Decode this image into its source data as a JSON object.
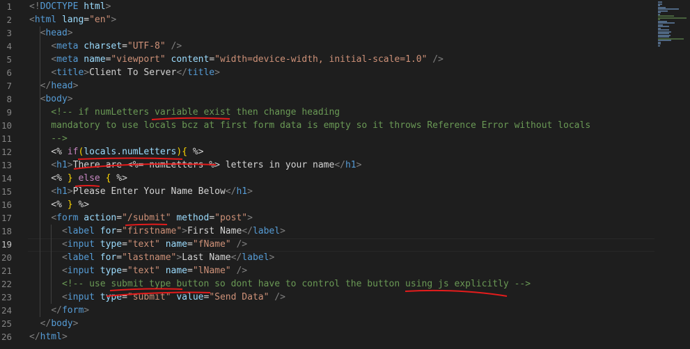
{
  "editor": {
    "active_line": 19,
    "lines": [
      {
        "n": "1",
        "t": [
          {
            "c": "t-p",
            "v": "<!"
          },
          {
            "c": "t-tag",
            "v": "DOCTYPE"
          },
          {
            "c": "t-text",
            "v": " "
          },
          {
            "c": "t-attr",
            "v": "html"
          },
          {
            "c": "t-p",
            "v": ">"
          }
        ]
      },
      {
        "n": "2",
        "t": [
          {
            "c": "t-p",
            "v": "<"
          },
          {
            "c": "t-tag",
            "v": "html"
          },
          {
            "c": "t-text",
            "v": " "
          },
          {
            "c": "t-attr",
            "v": "lang"
          },
          {
            "c": "t-text",
            "v": "="
          },
          {
            "c": "t-str",
            "v": "\"en\""
          },
          {
            "c": "t-p",
            "v": ">"
          }
        ]
      },
      {
        "n": "3",
        "t": [
          {
            "c": "t-text",
            "v": "  "
          },
          {
            "c": "t-p",
            "v": "<"
          },
          {
            "c": "t-tag",
            "v": "head"
          },
          {
            "c": "t-p",
            "v": ">"
          }
        ]
      },
      {
        "n": "4",
        "t": [
          {
            "c": "t-text",
            "v": "    "
          },
          {
            "c": "t-p",
            "v": "<"
          },
          {
            "c": "t-tag",
            "v": "meta"
          },
          {
            "c": "t-text",
            "v": " "
          },
          {
            "c": "t-attr",
            "v": "charset"
          },
          {
            "c": "t-text",
            "v": "="
          },
          {
            "c": "t-str",
            "v": "\"UTF-8\""
          },
          {
            "c": "t-text",
            "v": " "
          },
          {
            "c": "t-p",
            "v": "/>"
          }
        ]
      },
      {
        "n": "5",
        "t": [
          {
            "c": "t-text",
            "v": "    "
          },
          {
            "c": "t-p",
            "v": "<"
          },
          {
            "c": "t-tag",
            "v": "meta"
          },
          {
            "c": "t-text",
            "v": " "
          },
          {
            "c": "t-attr",
            "v": "name"
          },
          {
            "c": "t-text",
            "v": "="
          },
          {
            "c": "t-str",
            "v": "\"viewport\""
          },
          {
            "c": "t-text",
            "v": " "
          },
          {
            "c": "t-attr",
            "v": "content"
          },
          {
            "c": "t-text",
            "v": "="
          },
          {
            "c": "t-str",
            "v": "\"width=device-width, initial-scale=1.0\""
          },
          {
            "c": "t-text",
            "v": " "
          },
          {
            "c": "t-p",
            "v": "/>"
          }
        ]
      },
      {
        "n": "6",
        "t": [
          {
            "c": "t-text",
            "v": "    "
          },
          {
            "c": "t-p",
            "v": "<"
          },
          {
            "c": "t-tag",
            "v": "title"
          },
          {
            "c": "t-p",
            "v": ">"
          },
          {
            "c": "t-text",
            "v": "Client To Server"
          },
          {
            "c": "t-p",
            "v": "</"
          },
          {
            "c": "t-tag",
            "v": "title"
          },
          {
            "c": "t-p",
            "v": ">"
          }
        ]
      },
      {
        "n": "7",
        "t": [
          {
            "c": "t-text",
            "v": "  "
          },
          {
            "c": "t-p",
            "v": "</"
          },
          {
            "c": "t-tag",
            "v": "head"
          },
          {
            "c": "t-p",
            "v": ">"
          }
        ]
      },
      {
        "n": "8",
        "t": [
          {
            "c": "t-text",
            "v": "  "
          },
          {
            "c": "t-p",
            "v": "<"
          },
          {
            "c": "t-tag",
            "v": "body"
          },
          {
            "c": "t-p",
            "v": ">"
          }
        ]
      },
      {
        "n": "9",
        "t": [
          {
            "c": "t-com",
            "v": "    <!-- if numLetters variable exist then change heading"
          }
        ]
      },
      {
        "n": "10",
        "t": [
          {
            "c": "t-com",
            "v": "    mandatory to use locals bcz at first form data is empty so it throws Reference Error without locals"
          }
        ]
      },
      {
        "n": "11",
        "t": [
          {
            "c": "t-com",
            "v": "    -->"
          }
        ]
      },
      {
        "n": "12",
        "t": [
          {
            "c": "t-text",
            "v": "    <% "
          },
          {
            "c": "t-kw",
            "v": "if"
          },
          {
            "c": "t-br",
            "v": "("
          },
          {
            "c": "t-var",
            "v": "locals"
          },
          {
            "c": "t-text",
            "v": "."
          },
          {
            "c": "t-var",
            "v": "numLetters"
          },
          {
            "c": "t-br",
            "v": ")"
          },
          {
            "c": "t-br",
            "v": "{"
          },
          {
            "c": "t-text",
            "v": " %>"
          }
        ]
      },
      {
        "n": "13",
        "t": [
          {
            "c": "t-text",
            "v": "    "
          },
          {
            "c": "t-p",
            "v": "<"
          },
          {
            "c": "t-tag",
            "v": "h1"
          },
          {
            "c": "t-p",
            "v": ">"
          },
          {
            "c": "t-text",
            "v": "There are <%= numLetters %> letters in your name"
          },
          {
            "c": "t-p",
            "v": "</"
          },
          {
            "c": "t-tag",
            "v": "h1"
          },
          {
            "c": "t-p",
            "v": ">"
          }
        ]
      },
      {
        "n": "14",
        "t": [
          {
            "c": "t-text",
            "v": "    <% "
          },
          {
            "c": "t-br",
            "v": "}"
          },
          {
            "c": "t-text",
            "v": " "
          },
          {
            "c": "t-kw",
            "v": "else"
          },
          {
            "c": "t-text",
            "v": " "
          },
          {
            "c": "t-br",
            "v": "{"
          },
          {
            "c": "t-text",
            "v": " %>"
          }
        ]
      },
      {
        "n": "15",
        "t": [
          {
            "c": "t-text",
            "v": "    "
          },
          {
            "c": "t-p",
            "v": "<"
          },
          {
            "c": "t-tag",
            "v": "h1"
          },
          {
            "c": "t-p",
            "v": ">"
          },
          {
            "c": "t-text",
            "v": "Please Enter Your Name Below"
          },
          {
            "c": "t-p",
            "v": "</"
          },
          {
            "c": "t-tag",
            "v": "h1"
          },
          {
            "c": "t-p",
            "v": ">"
          }
        ]
      },
      {
        "n": "16",
        "t": [
          {
            "c": "t-text",
            "v": "    <% "
          },
          {
            "c": "t-br",
            "v": "}"
          },
          {
            "c": "t-text",
            "v": " %>"
          }
        ]
      },
      {
        "n": "17",
        "t": [
          {
            "c": "t-text",
            "v": "    "
          },
          {
            "c": "t-p",
            "v": "<"
          },
          {
            "c": "t-tag",
            "v": "form"
          },
          {
            "c": "t-text",
            "v": " "
          },
          {
            "c": "t-attr",
            "v": "action"
          },
          {
            "c": "t-text",
            "v": "="
          },
          {
            "c": "t-str",
            "v": "\"/submit\""
          },
          {
            "c": "t-text",
            "v": " "
          },
          {
            "c": "t-attr",
            "v": "method"
          },
          {
            "c": "t-text",
            "v": "="
          },
          {
            "c": "t-str",
            "v": "\"post\""
          },
          {
            "c": "t-p",
            "v": ">"
          }
        ]
      },
      {
        "n": "18",
        "t": [
          {
            "c": "t-text",
            "v": "      "
          },
          {
            "c": "t-p",
            "v": "<"
          },
          {
            "c": "t-tag",
            "v": "label"
          },
          {
            "c": "t-text",
            "v": " "
          },
          {
            "c": "t-attr",
            "v": "for"
          },
          {
            "c": "t-text",
            "v": "="
          },
          {
            "c": "t-str",
            "v": "\"firstname\""
          },
          {
            "c": "t-p",
            "v": ">"
          },
          {
            "c": "t-text",
            "v": "First Name"
          },
          {
            "c": "t-p",
            "v": "</"
          },
          {
            "c": "t-tag",
            "v": "label"
          },
          {
            "c": "t-p",
            "v": ">"
          }
        ]
      },
      {
        "n": "19",
        "t": [
          {
            "c": "t-text",
            "v": "      "
          },
          {
            "c": "t-p",
            "v": "<"
          },
          {
            "c": "t-tag",
            "v": "input"
          },
          {
            "c": "t-text",
            "v": " "
          },
          {
            "c": "t-attr",
            "v": "type"
          },
          {
            "c": "t-text",
            "v": "="
          },
          {
            "c": "t-str",
            "v": "\"text\""
          },
          {
            "c": "t-text",
            "v": " "
          },
          {
            "c": "t-attr",
            "v": "name"
          },
          {
            "c": "t-text",
            "v": "="
          },
          {
            "c": "t-str",
            "v": "\"fName\""
          },
          {
            "c": "t-text",
            "v": " "
          },
          {
            "c": "t-p",
            "v": "/>"
          }
        ]
      },
      {
        "n": "20",
        "t": [
          {
            "c": "t-text",
            "v": "      "
          },
          {
            "c": "t-p",
            "v": "<"
          },
          {
            "c": "t-tag",
            "v": "label"
          },
          {
            "c": "t-text",
            "v": " "
          },
          {
            "c": "t-attr",
            "v": "for"
          },
          {
            "c": "t-text",
            "v": "="
          },
          {
            "c": "t-str",
            "v": "\"lastname\""
          },
          {
            "c": "t-p",
            "v": ">"
          },
          {
            "c": "t-text",
            "v": "Last Name"
          },
          {
            "c": "t-p",
            "v": "</"
          },
          {
            "c": "t-tag",
            "v": "label"
          },
          {
            "c": "t-p",
            "v": ">"
          }
        ]
      },
      {
        "n": "21",
        "t": [
          {
            "c": "t-text",
            "v": "      "
          },
          {
            "c": "t-p",
            "v": "<"
          },
          {
            "c": "t-tag",
            "v": "input"
          },
          {
            "c": "t-text",
            "v": " "
          },
          {
            "c": "t-attr",
            "v": "type"
          },
          {
            "c": "t-text",
            "v": "="
          },
          {
            "c": "t-str",
            "v": "\"text\""
          },
          {
            "c": "t-text",
            "v": " "
          },
          {
            "c": "t-attr",
            "v": "name"
          },
          {
            "c": "t-text",
            "v": "="
          },
          {
            "c": "t-str",
            "v": "\"lName\""
          },
          {
            "c": "t-text",
            "v": " "
          },
          {
            "c": "t-p",
            "v": "/>"
          }
        ]
      },
      {
        "n": "22",
        "t": [
          {
            "c": "t-com",
            "v": "      <!-- use submit type button so dont have to control the button using js explicitly -->"
          }
        ]
      },
      {
        "n": "23",
        "t": [
          {
            "c": "t-text",
            "v": "      "
          },
          {
            "c": "t-p",
            "v": "<"
          },
          {
            "c": "t-tag",
            "v": "input"
          },
          {
            "c": "t-text",
            "v": " "
          },
          {
            "c": "t-attr",
            "v": "type"
          },
          {
            "c": "t-text",
            "v": "="
          },
          {
            "c": "t-str",
            "v": "\"submit\""
          },
          {
            "c": "t-text",
            "v": " "
          },
          {
            "c": "t-attr",
            "v": "value"
          },
          {
            "c": "t-text",
            "v": "="
          },
          {
            "c": "t-str",
            "v": "\"Send Data\""
          },
          {
            "c": "t-text",
            "v": " "
          },
          {
            "c": "t-p",
            "v": "/>"
          }
        ]
      },
      {
        "n": "24",
        "t": [
          {
            "c": "t-text",
            "v": "    "
          },
          {
            "c": "t-p",
            "v": "</"
          },
          {
            "c": "t-tag",
            "v": "form"
          },
          {
            "c": "t-p",
            "v": ">"
          }
        ]
      },
      {
        "n": "25",
        "t": [
          {
            "c": "t-text",
            "v": "  "
          },
          {
            "c": "t-p",
            "v": "</"
          },
          {
            "c": "t-tag",
            "v": "body"
          },
          {
            "c": "t-p",
            "v": ">"
          }
        ]
      },
      {
        "n": "26",
        "t": [
          {
            "c": "t-p",
            "v": "</"
          },
          {
            "c": "t-tag",
            "v": "html"
          },
          {
            "c": "t-p",
            "v": ">"
          }
        ]
      }
    ]
  }
}
